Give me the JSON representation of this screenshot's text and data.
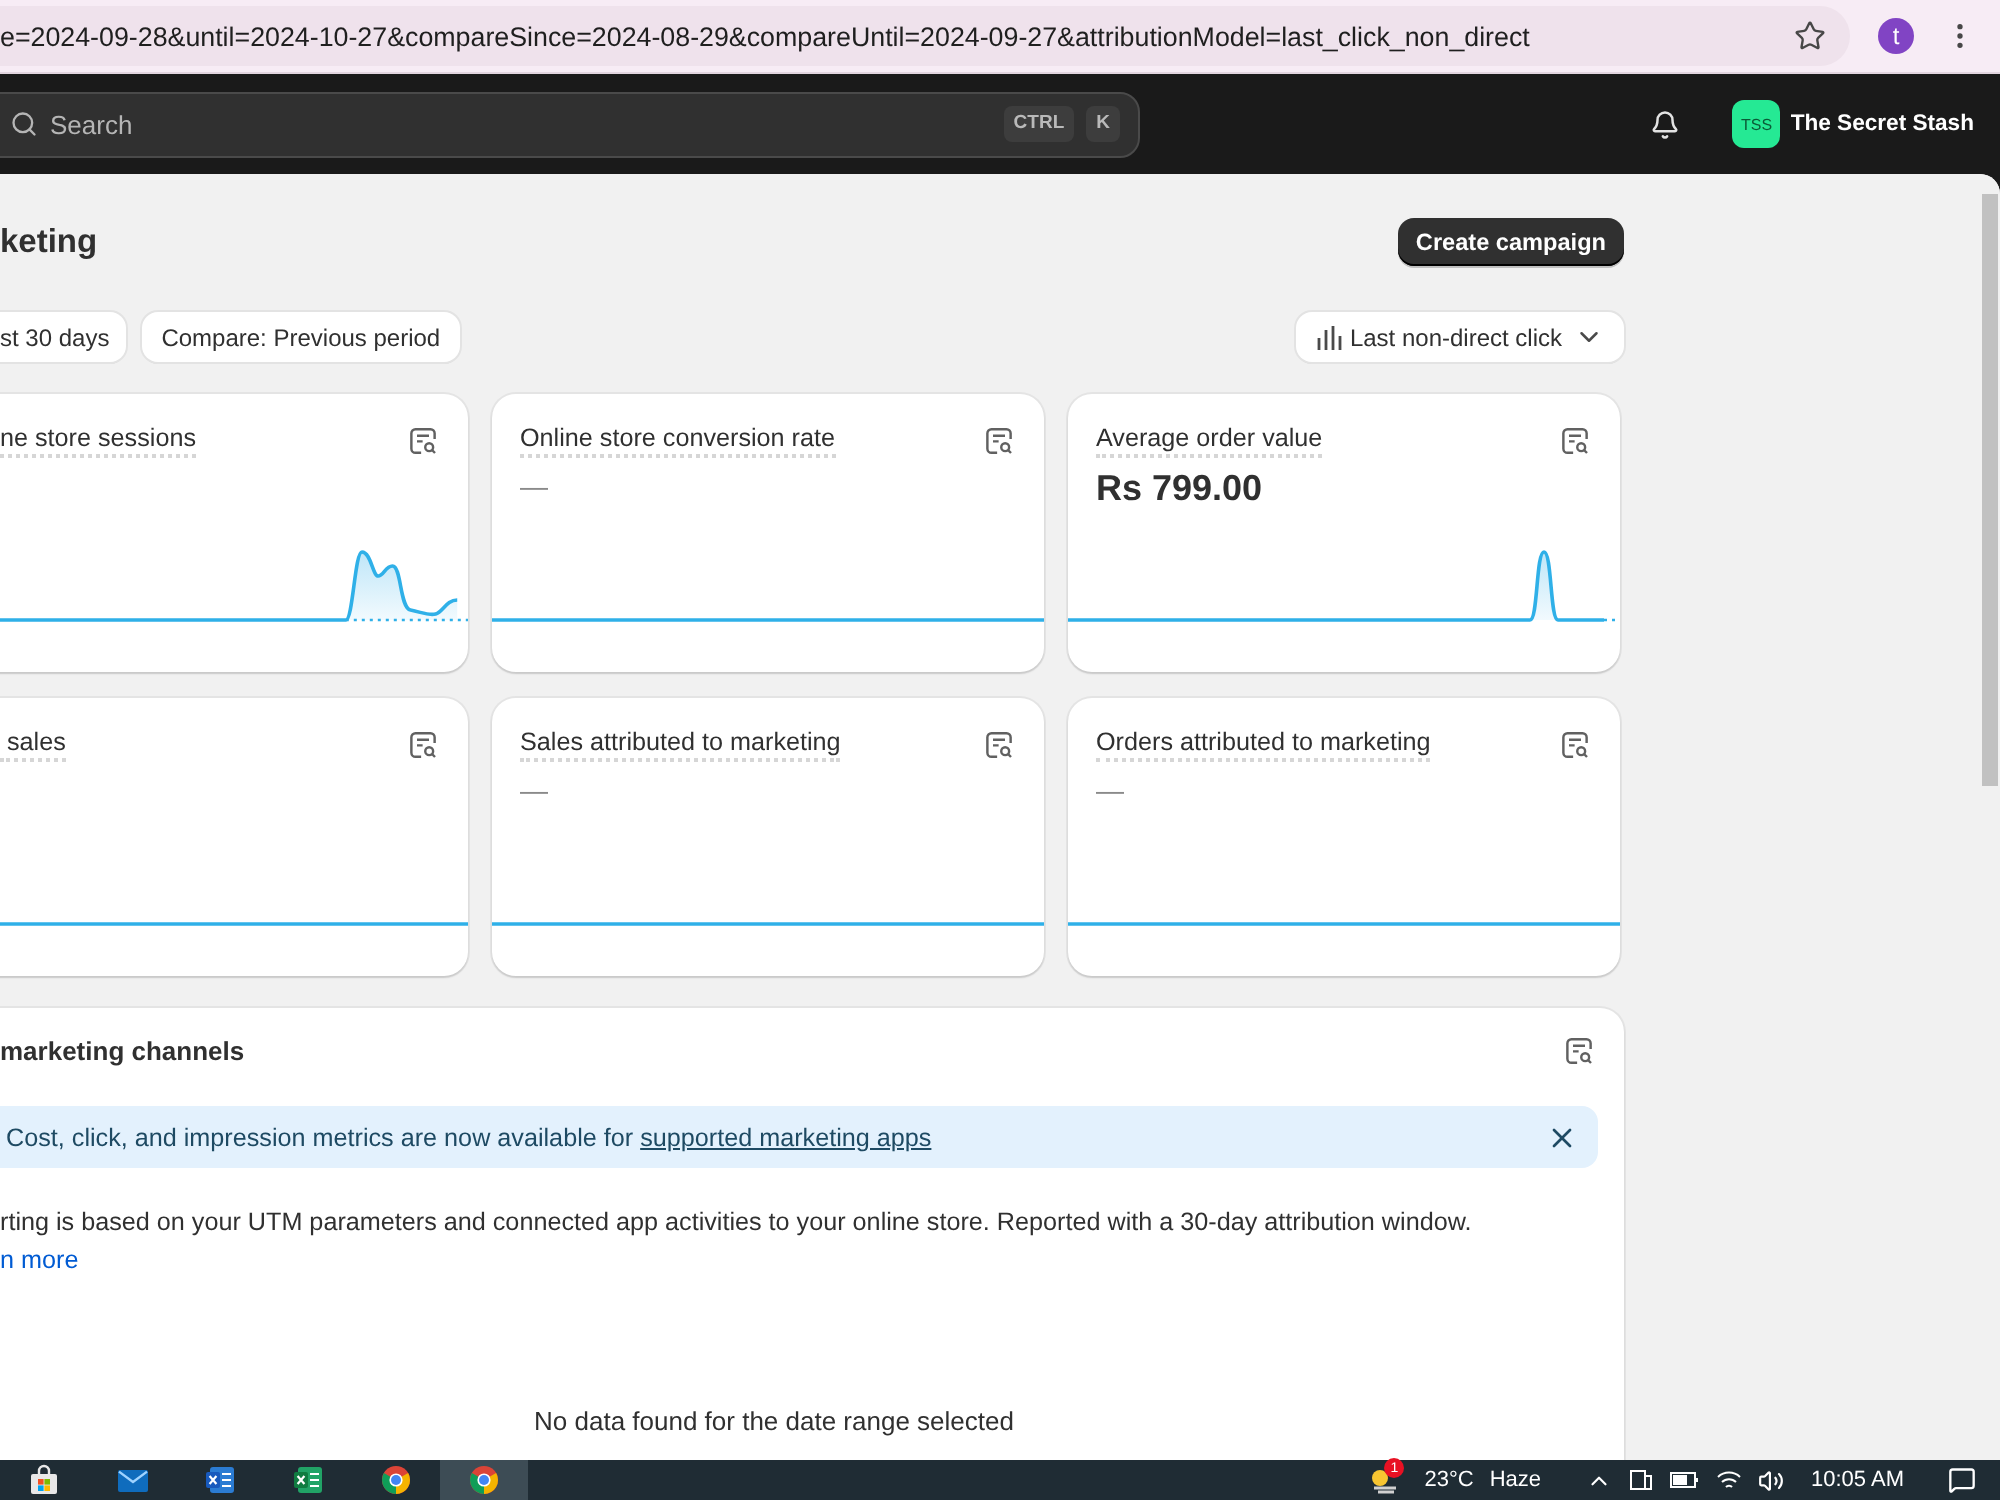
{
  "browser": {
    "url": "e=2024-09-28&until=2024-10-27&compareSince=2024-08-29&compareUntil=2024-09-27&attributionModel=last_click_non_direct",
    "profile_initial": "t"
  },
  "topbar": {
    "search": {
      "placeholder": "Search",
      "shortcut": [
        "CTRL",
        "K"
      ]
    },
    "store": {
      "initials": "TSS",
      "name": "The Secret Stash"
    }
  },
  "page": {
    "title": "keting",
    "action": "Create campaign"
  },
  "filters": {
    "date_range": "st 30 days",
    "compare": "Compare: Previous period",
    "attribution": "Last non-direct click"
  },
  "metrics": [
    {
      "title": "ne store sessions",
      "kind": "peaks"
    },
    {
      "title": "Online store conversion rate",
      "value": {
        "text": "—",
        "kind": "empty"
      },
      "kind": "flat"
    },
    {
      "title": "Average order value",
      "value": {
        "text": "Rs 799.00",
        "kind": "amount"
      },
      "kind": "spike"
    },
    {
      "title": "sales",
      "kind": "flat"
    },
    {
      "title": "Sales attributed to marketing",
      "value": {
        "text": "—",
        "kind": "empty"
      },
      "kind": "flat"
    },
    {
      "title": "Orders attributed to marketing",
      "value": {
        "text": "—",
        "kind": "empty"
      },
      "kind": "flat"
    }
  ],
  "channels": {
    "title": "marketing channels",
    "banner": {
      "text": "Cost, click, and impression metrics are now available for",
      "link": "supported marketing apps"
    },
    "description": "rting is based on your UTM parameters and connected app activities to your online store. Reported with a 30-day attribution window.",
    "learn_more": "n more",
    "empty_state": "No data found for the date range selected"
  },
  "taskbar": {
    "apps": [
      {
        "kind": "store",
        "selected": false
      },
      {
        "kind": "mail",
        "selected": false
      },
      {
        "kind": "word",
        "selected": false
      },
      {
        "kind": "excel",
        "selected": false
      },
      {
        "kind": "chrome",
        "selected": false
      },
      {
        "kind": "chrome",
        "selected": true
      }
    ],
    "weather": {
      "badge": "1",
      "temperature": "23°C",
      "condition": "Haze"
    },
    "clock": "10:05 AM"
  }
}
